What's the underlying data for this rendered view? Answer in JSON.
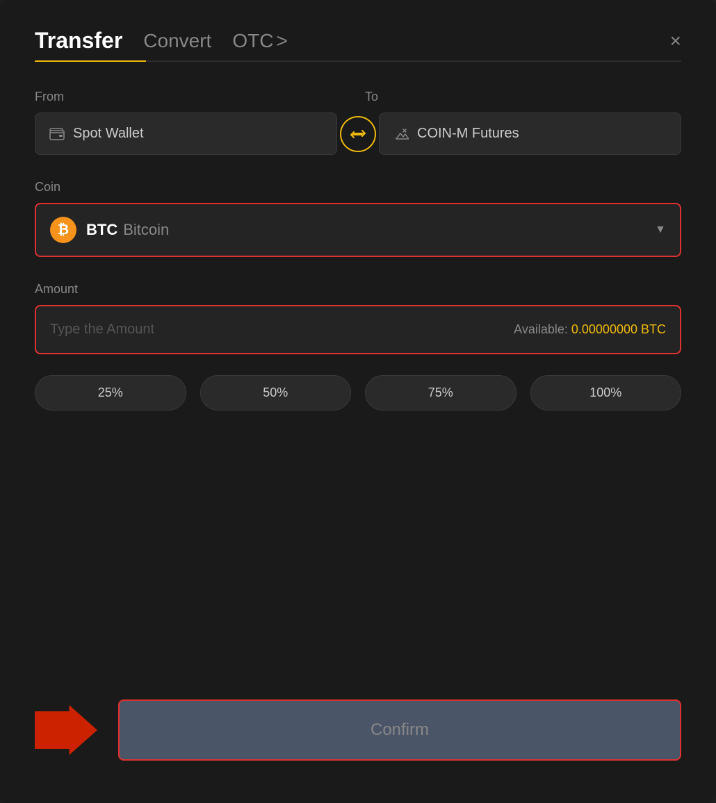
{
  "header": {
    "title": "Transfer",
    "tab_convert": "Convert",
    "tab_otc": "OTC",
    "tab_otc_chevron": ">",
    "close_label": "×"
  },
  "from_section": {
    "label": "From",
    "wallet_text": "Spot Wallet"
  },
  "to_section": {
    "label": "To",
    "wallet_text": "COIN-M Futures"
  },
  "coin_section": {
    "label": "Coin",
    "symbol": "BTC",
    "name": "Bitcoin"
  },
  "amount_section": {
    "label": "Amount",
    "placeholder": "Type the Amount",
    "available_label": "Available:",
    "available_value": "0.00000000 BTC"
  },
  "pct_buttons": {
    "btn25": "25%",
    "btn50": "50%",
    "btn75": "75%",
    "btn100": "100%"
  },
  "confirm_btn": {
    "label": "Confirm"
  }
}
